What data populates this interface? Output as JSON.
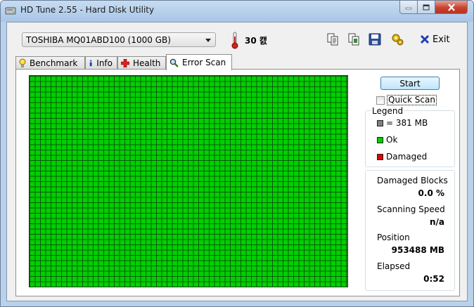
{
  "window": {
    "title": "HD Tune 2.55 - Hard Disk Utility"
  },
  "toolbar": {
    "drive": "TOSHIBA MQ01ABD100 (1000 GB)",
    "temperature": "30 캜",
    "exit_label": "Exit"
  },
  "tabs": [
    {
      "label": "Benchmark",
      "icon": "lightbulb-icon"
    },
    {
      "label": "Info",
      "icon": "info-icon"
    },
    {
      "label": "Health",
      "icon": "health-cross-icon"
    },
    {
      "label": "Error Scan",
      "icon": "magnifier-icon",
      "active": true
    }
  ],
  "scan": {
    "start_label": "Start",
    "quick_scan_label": "Quick Scan",
    "quick_scan_checked": false,
    "blocks_state": "all ok"
  },
  "legend": {
    "title": "Legend",
    "block_size": "= 381 MB",
    "ok": "Ok",
    "damaged": "Damaged",
    "colors": {
      "block": "#808080",
      "ok": "#00d000",
      "damaged": "#e00000"
    }
  },
  "stats": {
    "damaged_blocks_label": "Damaged Blocks",
    "damaged_blocks_value": "0.0 %",
    "scanning_speed_label": "Scanning Speed",
    "scanning_speed_value": "n/a",
    "position_label": "Position",
    "position_value": "953488 MB",
    "elapsed_label": "Elapsed",
    "elapsed_value": "0:52"
  }
}
